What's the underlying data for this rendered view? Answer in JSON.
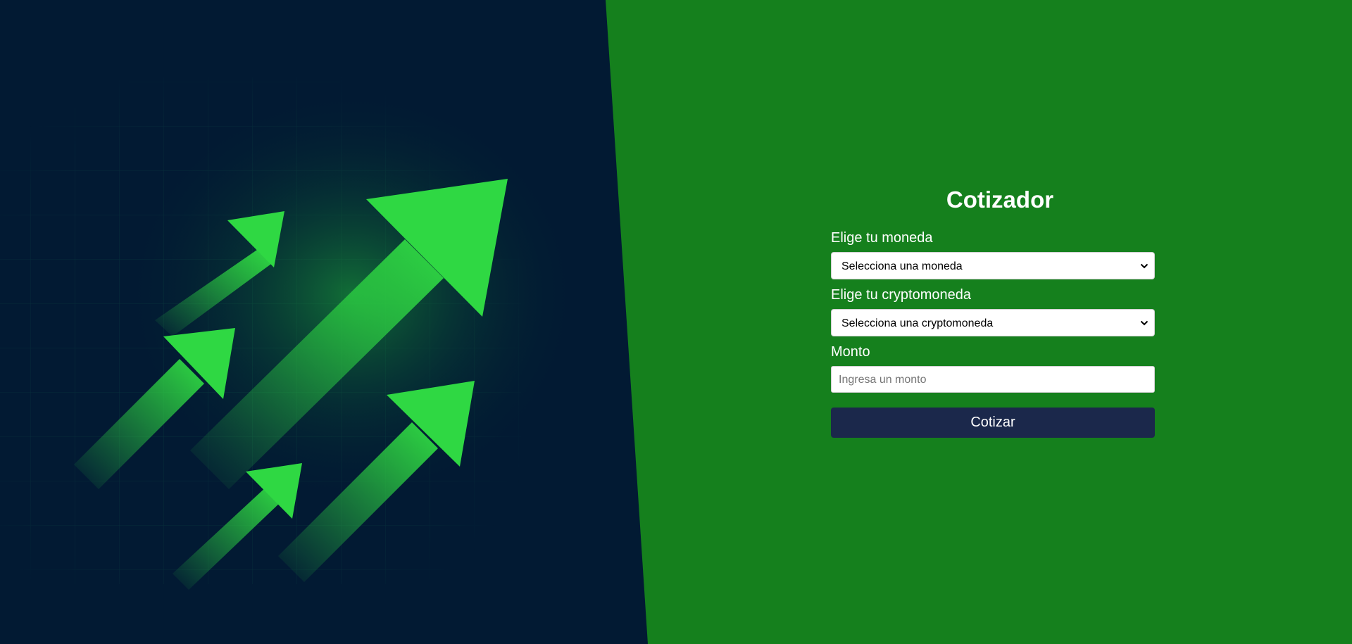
{
  "form": {
    "title": "Cotizador",
    "currency_label": "Elige tu moneda",
    "currency_selected": "Selecciona una moneda",
    "crypto_label": "Elige tu cryptomoneda",
    "crypto_selected": "Selecciona una cryptomoneda",
    "amount_label": "Monto",
    "amount_placeholder": "Ingresa un monto",
    "submit_label": "Cotizar"
  },
  "colors": {
    "panel_background": "#15801d",
    "hero_background": "#021a33",
    "arrow_green": "#2fd843",
    "button_background": "#1b284b"
  },
  "icons": {
    "hero": "growth-arrows-illustration",
    "select_indicator": "chevron-down-icon"
  }
}
